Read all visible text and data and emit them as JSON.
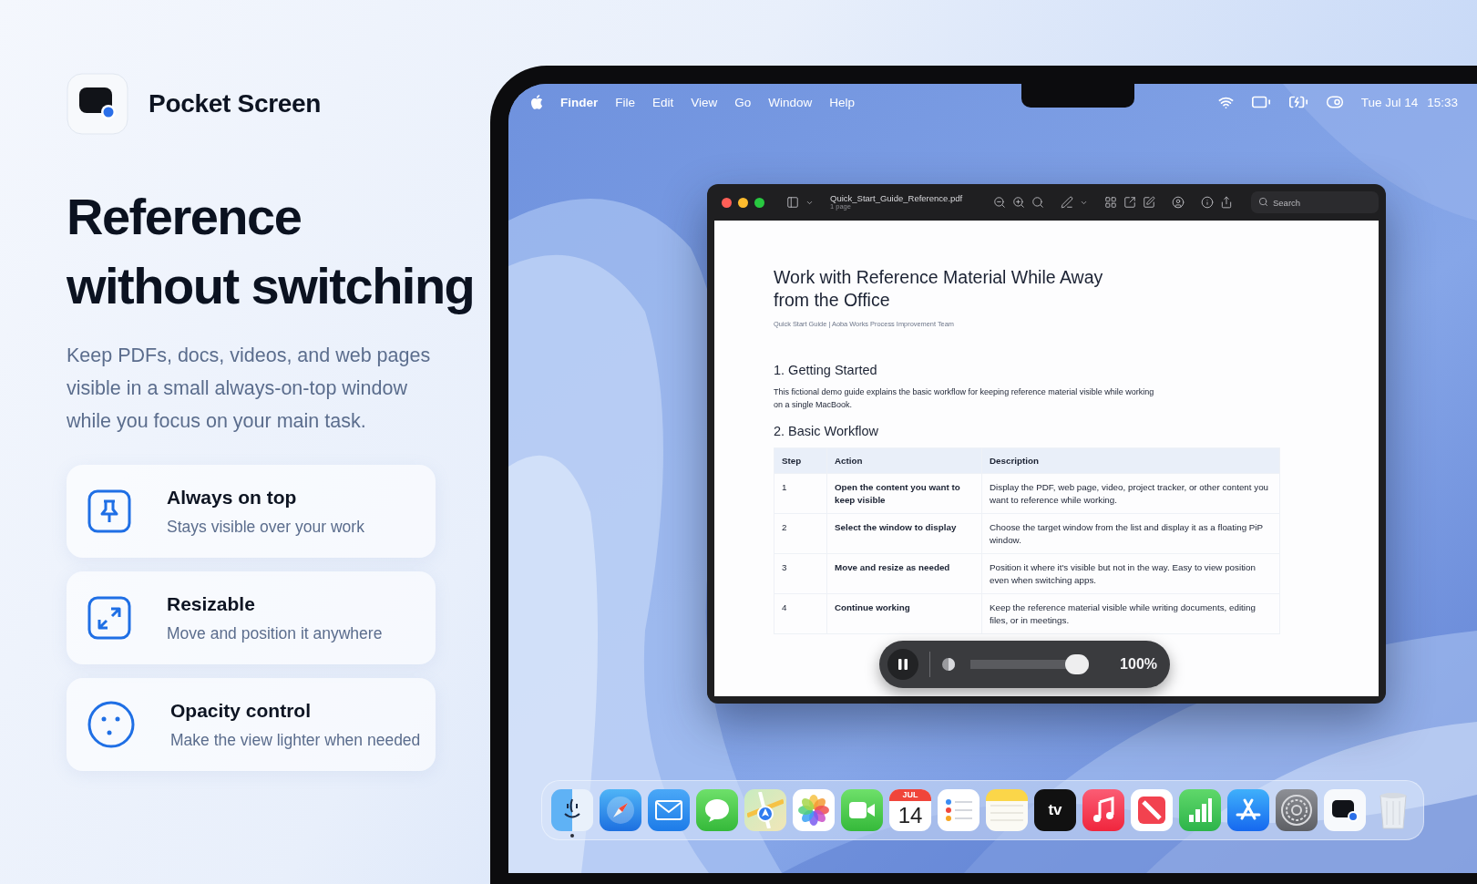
{
  "app": {
    "name": "Pocket Screen"
  },
  "headline_lines": [
    "Reference",
    "without switching"
  ],
  "tagline": "Keep PDFs, docs, videos, and web pages visible in a small always-on-top window while you focus on your main task.",
  "features": [
    {
      "kind": "pin",
      "title": "Always on top",
      "subtitle": "Stays visible over your work"
    },
    {
      "kind": "resize",
      "title": "Resizable",
      "subtitle": "Move and position it anywhere"
    },
    {
      "kind": "opacity",
      "title": "Opacity control",
      "subtitle": "Make the view lighter when needed"
    }
  ],
  "menubar": {
    "items": [
      {
        "kind": "app",
        "label": "Finder"
      },
      {
        "kind": "menu",
        "label": "File"
      },
      {
        "kind": "menu",
        "label": "Edit"
      },
      {
        "kind": "menu",
        "label": "View"
      },
      {
        "kind": "menu",
        "label": "Go"
      },
      {
        "kind": "menu",
        "label": "Window"
      },
      {
        "kind": "menu",
        "label": "Help"
      }
    ],
    "date": "Tue Jul 14",
    "time": "15:33"
  },
  "pdf_window": {
    "filename": "Quick_Start_Guide_Reference.pdf",
    "page_count": "1 page",
    "search_placeholder": "Search",
    "document": {
      "title": "Work with Reference Material While Away from the Office",
      "byline": "Quick Start Guide | Aoba Works Process Improvement Team",
      "sections": [
        {
          "heading": "1. Getting Started",
          "body": "This fictional demo guide explains the basic workflow for keeping reference material visible while working on a single MacBook."
        },
        {
          "heading": "2. Basic Workflow"
        }
      ],
      "table": {
        "columns": [
          "Step",
          "Action",
          "Description"
        ],
        "rows": [
          [
            "1",
            "Open the content you want to keep visible",
            "Display the PDF, web page, video, project tracker, or other content you want to reference while working."
          ],
          [
            "2",
            "Select the window to display",
            "Choose the target window from the list and display it as a floating PiP window."
          ],
          [
            "3",
            "Move and resize as needed",
            "Position it where it's visible but not in the way. Easy to view position even when switching apps."
          ],
          [
            "4",
            "Continue working",
            "Keep the reference material visible while writing documents, editing files, or in meetings."
          ]
        ]
      }
    }
  },
  "pip_controls": {
    "playing": true,
    "opacity": {
      "level": 1
    },
    "reading": "100%"
  },
  "dock": {
    "items": [
      {
        "kind": "finder",
        "running": true
      },
      {
        "kind": "safari",
        "running": false
      },
      {
        "kind": "mail",
        "running": false
      },
      {
        "kind": "messages",
        "running": false
      },
      {
        "kind": "maps",
        "running": false
      },
      {
        "kind": "photos",
        "running": false
      },
      {
        "kind": "facetime",
        "running": false
      },
      {
        "kind": "calendar",
        "running": false,
        "month": "JUL",
        "day": "14"
      },
      {
        "kind": "reminders",
        "running": false
      },
      {
        "kind": "notes",
        "running": false
      },
      {
        "kind": "tv",
        "running": false,
        "label": "tv"
      },
      {
        "kind": "music",
        "running": false
      },
      {
        "kind": "news",
        "running": false
      },
      {
        "kind": "numbers",
        "running": false
      },
      {
        "kind": "appstore",
        "running": false
      },
      {
        "kind": "settings",
        "running": false
      },
      {
        "kind": "pocketscreen",
        "running": false
      },
      {
        "kind": "trash",
        "running": false
      }
    ]
  }
}
